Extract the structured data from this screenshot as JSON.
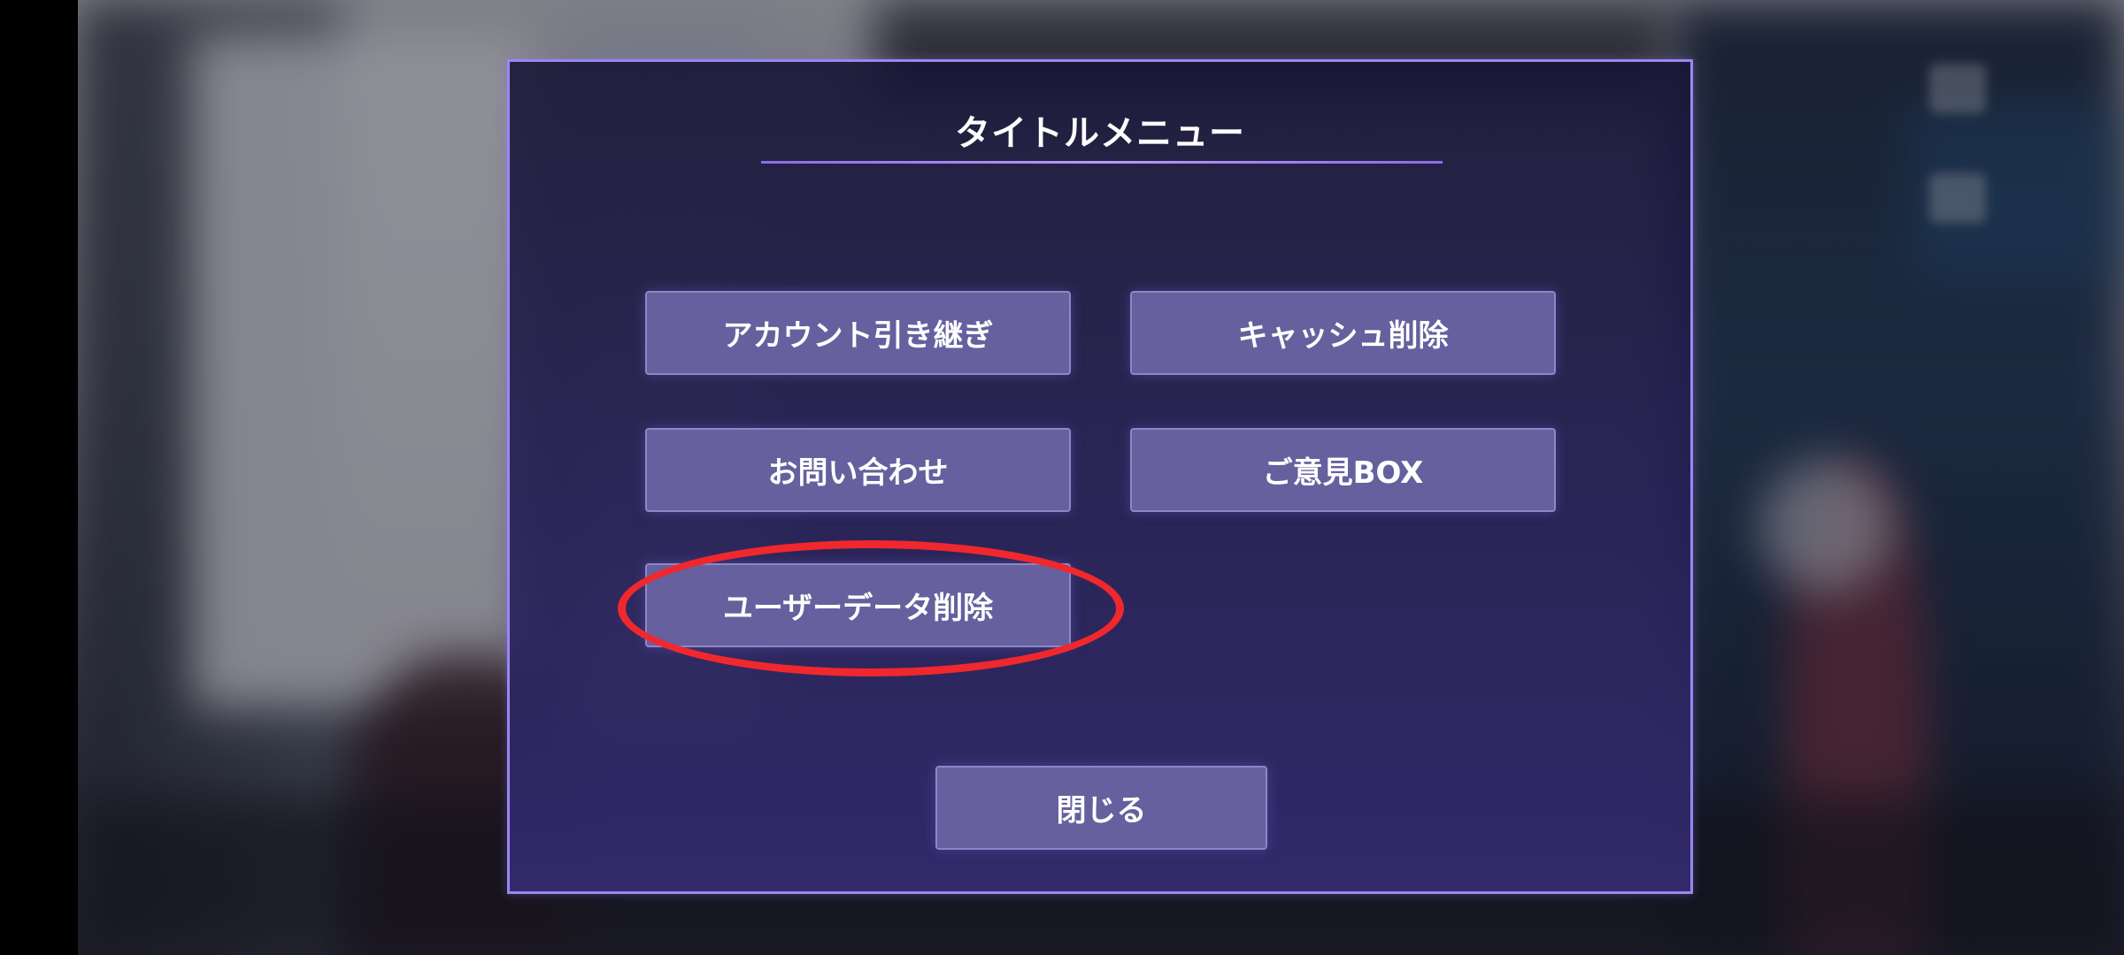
{
  "dialog": {
    "title": "タイトルメニュー",
    "buttons": {
      "account_transfer": "アカウント引き継ぎ",
      "delete_cache": "キャッシュ削除",
      "contact": "お問い合わせ",
      "feedback_box": "ご意見BOX",
      "delete_user_data": "ユーザーデータ削除",
      "close": "閉じる"
    }
  },
  "colors": {
    "dialog_border": "#9b86f2",
    "button_fill": "#66609e",
    "highlight_ring": "#f0282d"
  },
  "icons": [
    "side-menu-icon",
    "side-menu-icon"
  ]
}
